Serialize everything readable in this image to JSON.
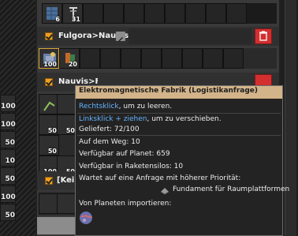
{
  "left_column": {
    "counts": [
      "100",
      "100",
      "50",
      "10",
      "50",
      "100",
      "50"
    ]
  },
  "top_row": {
    "items": [
      {
        "icon": "solar-panel-icon",
        "count": "6"
      },
      {
        "icon": "electric-pole-icon",
        "count": "31"
      }
    ]
  },
  "section1": {
    "title": "Fulgora>Nauvis",
    "items": [
      {
        "icon": "electromagnetic-plant-icon",
        "count": "100"
      },
      {
        "icon": "supercapacitor-icon",
        "count": "20"
      }
    ]
  },
  "section2": {
    "title_partial": "Nauvis>Fulgora",
    "counts": [
      "50",
      "50",
      "50",
      "100",
      "50"
    ]
  },
  "section3": {
    "title_partial": "[Kein..."
  },
  "tooltip": {
    "title": "Elektromagnetische Fabrik (Logistikanfrage)",
    "rightclick_action": "Rechtsklick",
    "rightclick_text": ", um zu leeren.",
    "leftclick_action": "Linksklick + ziehen",
    "leftclick_text": ", um zu verschieben.",
    "delivered": "Geliefert: 72/100",
    "on_the_way": "Auf dem Weg: 10",
    "available_planet": "Verfügbar auf Planet: 659",
    "available_silos": "Verfügbar in Raketensilos: 10",
    "waiting_label": "Wartet auf eine Anfrage mit höherer Priorität:",
    "waiting_item": "Fundament für Raumplattformen",
    "import_label": "Von Planeten importieren:"
  }
}
